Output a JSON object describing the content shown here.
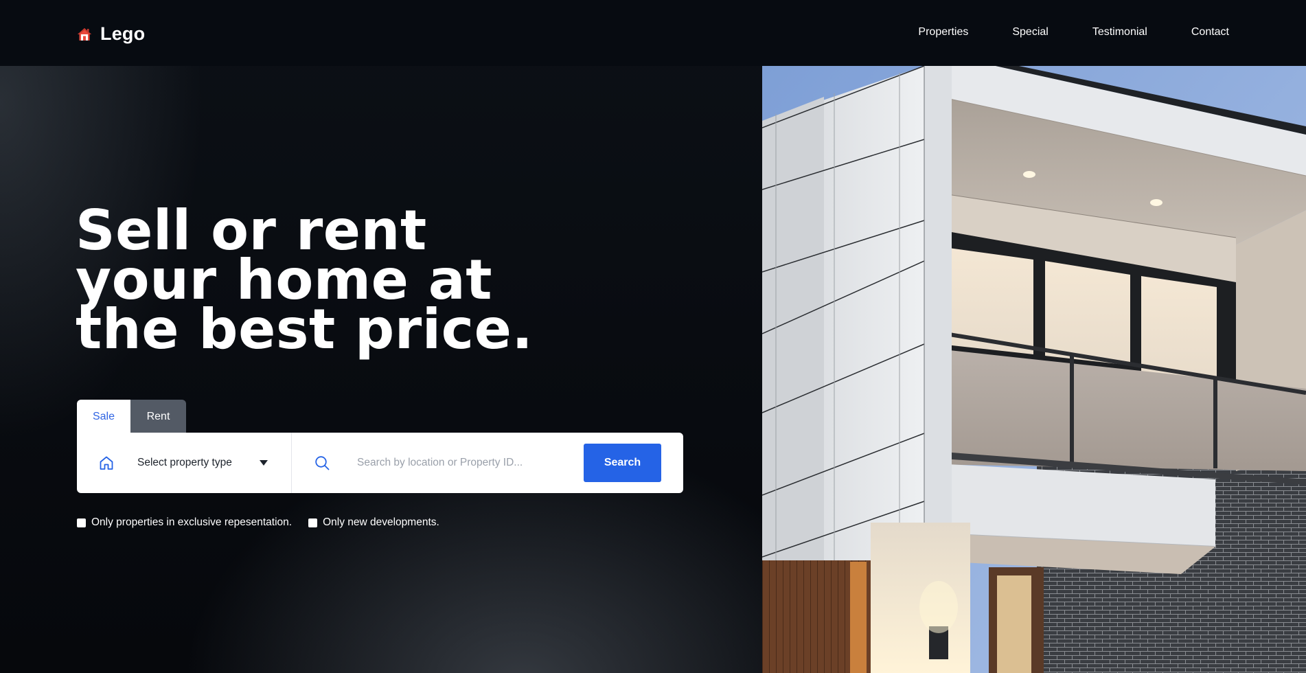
{
  "header": {
    "logo_text": "Lego",
    "logo_icon": "house-icon",
    "nav": [
      "Properties",
      "Special",
      "Testimonial",
      "Contact"
    ]
  },
  "hero": {
    "headline_lines": [
      "Sell or rent",
      "your home at",
      "the best price."
    ],
    "image_description_icon": "modern-house-photo"
  },
  "search": {
    "tabs": [
      "Sale",
      "Rent"
    ],
    "active_tab": "Sale",
    "property_type_label": "Select property type",
    "input_placeholder": "Search by location or Property ID...",
    "input_value": "",
    "button_label": "Search"
  },
  "filters": [
    {
      "label": "Only properties in exclusive repesentation.",
      "checked": false
    },
    {
      "label": "Only new developments.",
      "checked": false
    }
  ],
  "colors": {
    "accent": "#2563e6",
    "tab_active_text": "#2f64e3",
    "tab_inactive_bg": "#535a65",
    "background": "#070b11"
  }
}
